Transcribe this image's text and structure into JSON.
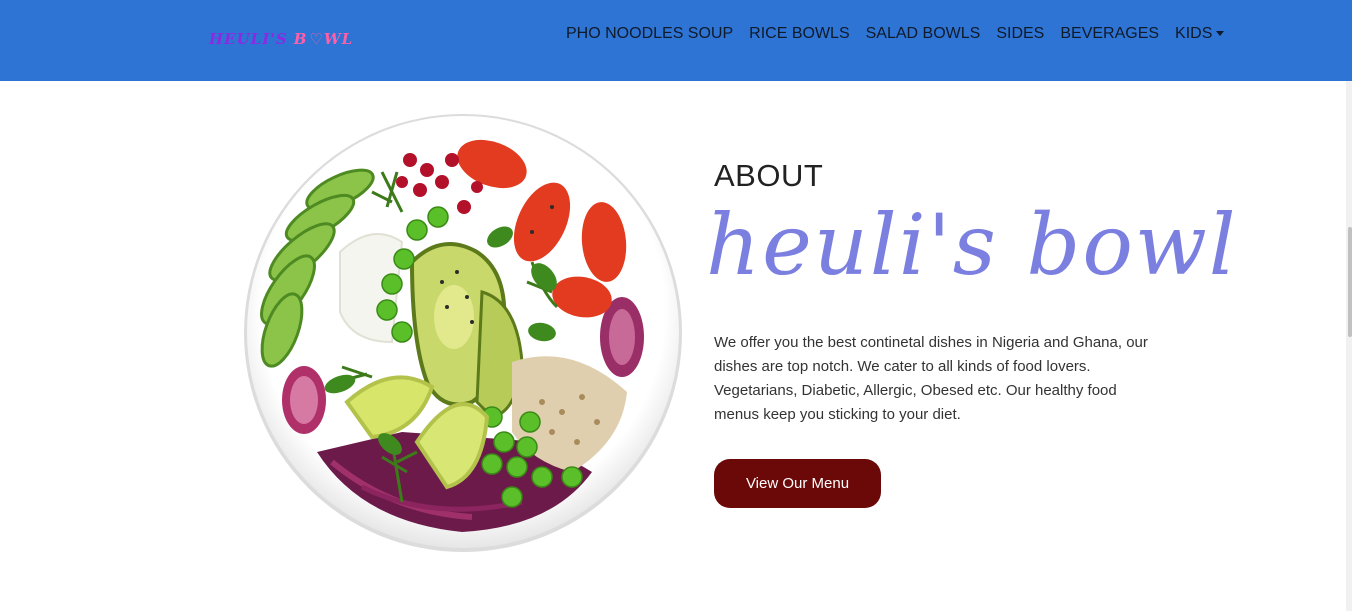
{
  "brand": {
    "logo_part1": "HEULI'S",
    "logo_part2": "B",
    "logo_heart": "♡",
    "logo_part3": "WL",
    "nav_color": "#2e74d4"
  },
  "nav": {
    "items": [
      {
        "label": "PHO NOODLES SOUP"
      },
      {
        "label": "RICE BOWLS"
      },
      {
        "label": "SALAD BOWLS"
      },
      {
        "label": "SIDES"
      },
      {
        "label": "BEVERAGES"
      },
      {
        "label": "KIDS"
      }
    ]
  },
  "hero": {
    "heading": "ABOUT",
    "script_title": "heuli's bowl",
    "description": "We offer you the best continetal dishes in Nigeria and Ghana, our dishes are top notch. We cater to all kinds of food lovers. Vegetarians, Diabetic, Allergic, Obesed etc. Our healthy food menus keep you sticking to your diet.",
    "button_label": "View Our Menu",
    "button_color": "#6b0808",
    "script_color": "#7b7fe0"
  }
}
